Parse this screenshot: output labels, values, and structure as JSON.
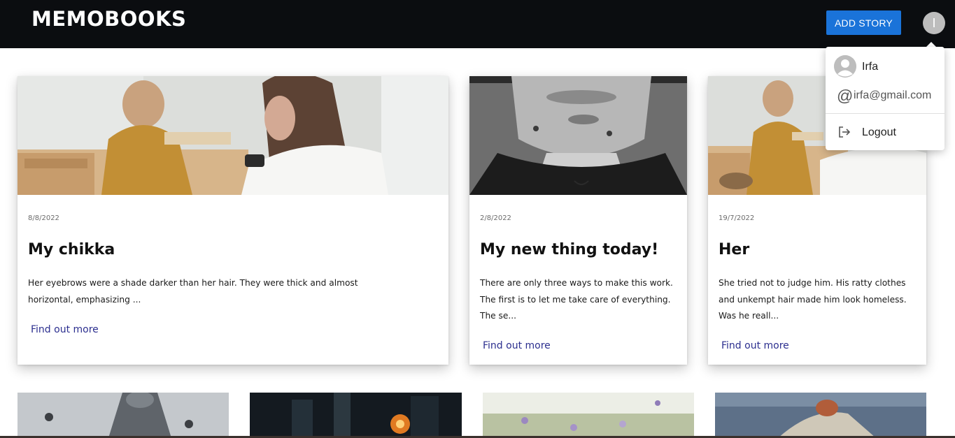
{
  "header": {
    "brand": "MEMOBOOKS",
    "add_story_label": "ADD STORY",
    "avatar_initial": "I"
  },
  "user_menu": {
    "name": "Irfa",
    "email": "irfa@gmail.com",
    "logout_label": "Logout"
  },
  "stories": [
    {
      "date": "8/8/2022",
      "title": "My chikka",
      "excerpt": "Her eyebrows were a shade darker than her hair. They were thick and almost horizontal, emphasizing ...",
      "link_label": "Find out more"
    },
    {
      "date": "2/8/2022",
      "title": "My new thing today!",
      "excerpt": "There are only three ways to make this work. The first is to let me take care of everything. The se...",
      "link_label": "Find out more"
    },
    {
      "date": "19/7/2022",
      "title": "Her",
      "excerpt": "She tried not to judge him. His ratty clothes and unkempt hair made him look homeless. Was he reall...",
      "link_label": "Find out more"
    }
  ],
  "colors": {
    "topbar": "#0b0d10",
    "accent_button": "#1a73d9",
    "link": "#2c2f8f"
  }
}
